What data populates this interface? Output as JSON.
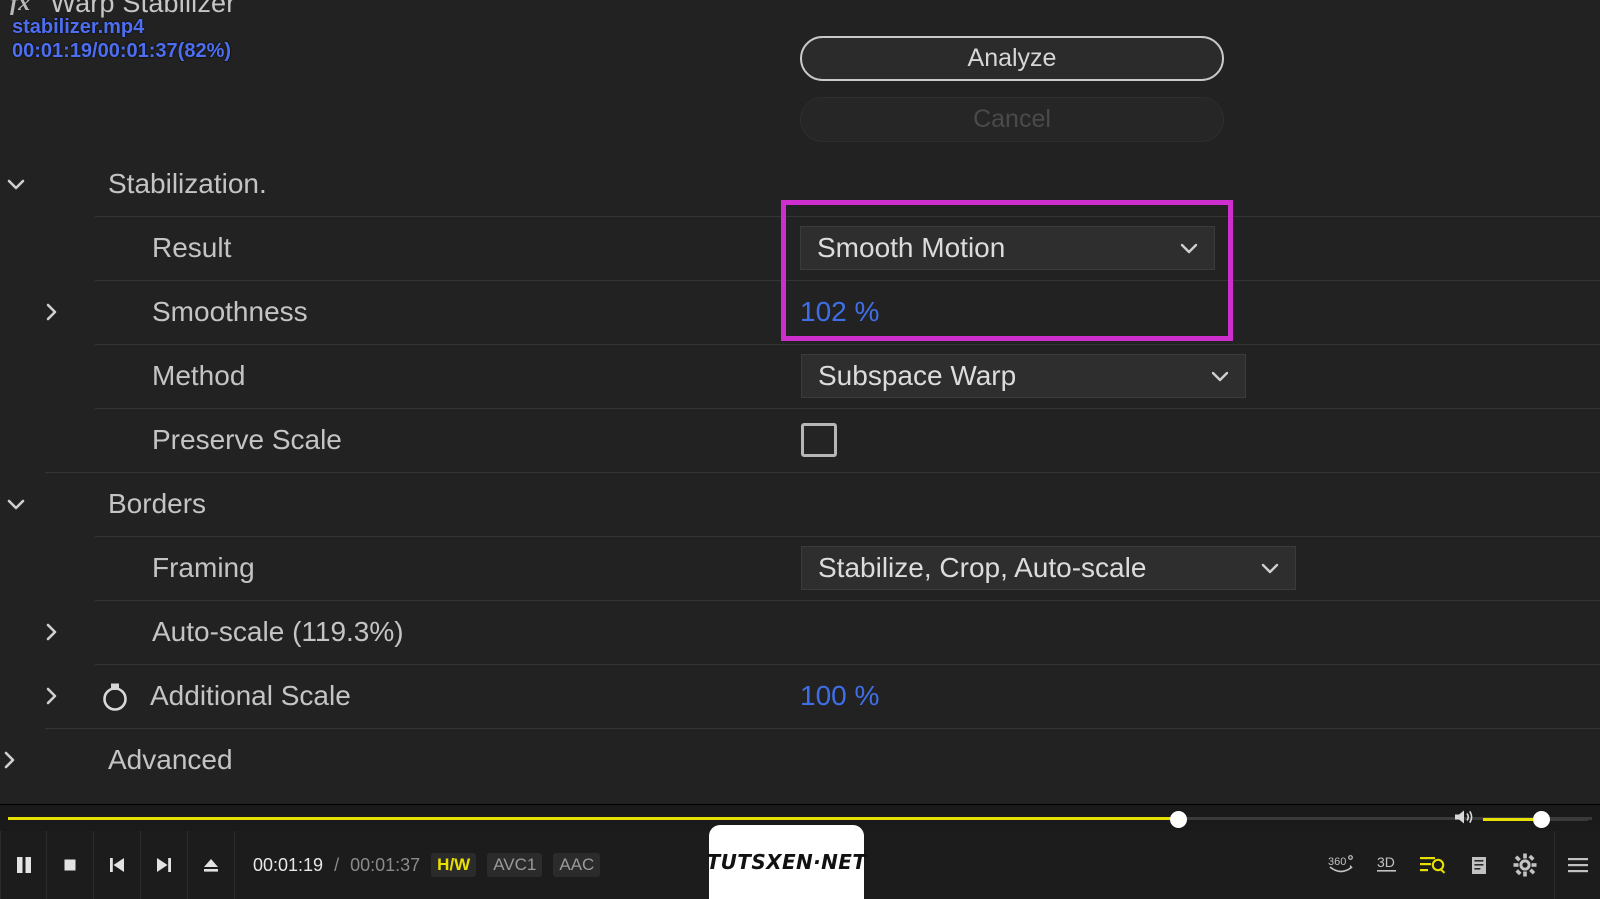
{
  "effect": {
    "fx_glyph": "fx",
    "title": "Warp Stabilizer"
  },
  "analysis": {
    "clip_name": "stabilizer.mp4",
    "progress_text": "00:01:19/00:01:37(82%)"
  },
  "buttons": {
    "analyze": "Analyze",
    "cancel": "Cancel"
  },
  "groups": {
    "stabilization": "Stabilization.",
    "borders": "Borders",
    "advanced": "Advanced"
  },
  "properties": {
    "result": {
      "label": "Result",
      "value": "Smooth Motion"
    },
    "smoothness": {
      "label": "Smoothness",
      "value": "102 %"
    },
    "method": {
      "label": "Method",
      "value": "Subspace Warp"
    },
    "preserve_scale": {
      "label": "Preserve Scale",
      "checked": "false"
    },
    "framing": {
      "label": "Framing",
      "value": "Stabilize, Crop, Auto-scale"
    },
    "auto_scale": {
      "label": "Auto-scale (119.3%)"
    },
    "additional_scale": {
      "label": "Additional Scale",
      "value": "100 %"
    }
  },
  "highlight": {
    "color": "#cd2ecd"
  },
  "player": {
    "current_time": "00:01:19",
    "separator": "/",
    "total_time": "00:01:37",
    "badges": [
      "H/W",
      "AVC1",
      "AAC"
    ],
    "right_icons": [
      "360-icon",
      "3d-icon",
      "settings-search-icon",
      "list-icon",
      "gear-icon",
      "hamburger-menu-icon"
    ],
    "accent_color": "#e8e000"
  },
  "watermark": {
    "text": "TUTSXEN·NET"
  }
}
